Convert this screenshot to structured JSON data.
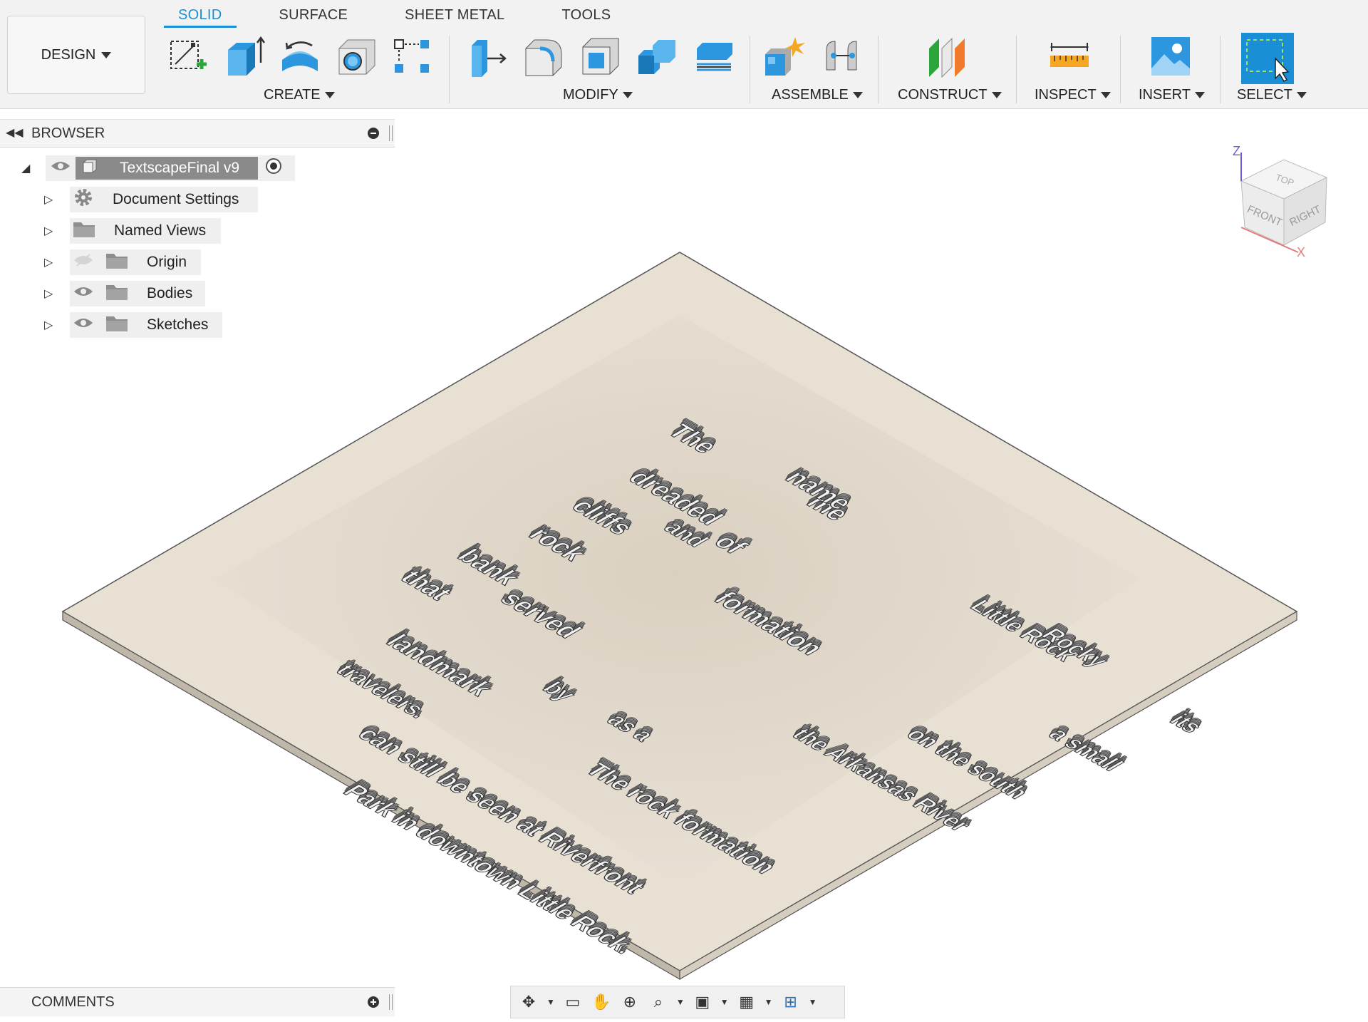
{
  "workspace": {
    "label": "DESIGN"
  },
  "tabs": [
    {
      "label": "SOLID",
      "active": true
    },
    {
      "label": "SURFACE",
      "active": false
    },
    {
      "label": "SHEET METAL",
      "active": false
    },
    {
      "label": "TOOLS",
      "active": false
    }
  ],
  "groups": {
    "create": "CREATE",
    "modify": "MODIFY",
    "assemble": "ASSEMBLE",
    "construct": "CONSTRUCT",
    "inspect": "INSPECT",
    "insert": "INSERT",
    "select": "SELECT"
  },
  "icons": {
    "create": [
      "create-sketch-icon",
      "extrude-icon",
      "revolve-icon",
      "hole-icon",
      "pattern-icon"
    ],
    "modify": [
      "press-pull-icon",
      "fillet-icon",
      "shell-icon",
      "combine-icon",
      "offset-plane-icon"
    ],
    "assemble": [
      "new-component-icon",
      "joint-icon"
    ],
    "construct": [
      "construct-plane-icon"
    ],
    "inspect": [
      "measure-icon"
    ],
    "insert": [
      "insert-image-icon"
    ],
    "select": [
      "select-window-icon"
    ]
  },
  "browser": {
    "title": "BROWSER",
    "root": {
      "label": "TextscapeFinal v9"
    },
    "items": [
      {
        "label": "Document Settings",
        "icon": "gear-icon",
        "visible": null
      },
      {
        "label": "Named Views",
        "icon": "folder-icon",
        "visible": null
      },
      {
        "label": "Origin",
        "icon": "folder-icon",
        "visible": false
      },
      {
        "label": "Bodies",
        "icon": "folder-icon",
        "visible": true
      },
      {
        "label": "Sketches",
        "icon": "folder-icon",
        "visible": true
      }
    ]
  },
  "viewcube": {
    "top": "TOP",
    "front": "FRONT",
    "right": "RIGHT",
    "axis_z": "Z",
    "axis_x": "X"
  },
  "model_text": [
    "The",
    "dreaded",
    "me",
    "cliffs",
    "and",
    "rock",
    "formation",
    "bank",
    "of",
    "that",
    "served",
    "as a",
    "landmark",
    "by",
    "the Arkansas River",
    "on the south",
    "travelers.",
    "The rock formation",
    "can still be seen at Riverfront",
    "Park in downtown Little Rock.",
    "Little Rock",
    "Rocky",
    "a small",
    "its",
    "name"
  ],
  "comments": {
    "title": "COMMENTS"
  },
  "nav_icons": [
    "orbit-icon",
    "look-at-icon",
    "pan-icon",
    "zoom-icon",
    "fit-icon",
    "display-settings-icon",
    "grid-icon",
    "viewports-icon"
  ]
}
